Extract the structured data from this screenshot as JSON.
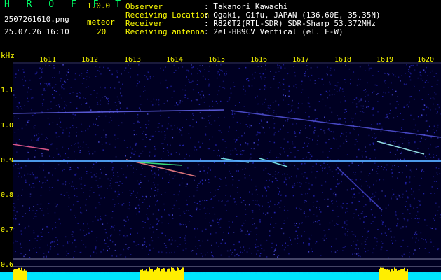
{
  "header": {
    "app_title": "H R O F F T",
    "app_version": "1.0.0",
    "file_name": "2507261610.png",
    "date_time": "25.07.26 16:10",
    "meteor_label": "meteor",
    "meteor_count": "20"
  },
  "station_info": [
    {
      "label": "Observer",
      "value": ": Takanori Kawachi"
    },
    {
      "label": "Receiving Location",
      "value": ": Ogaki, Gifu, JAPAN (136.60E, 35.35N)"
    },
    {
      "label": "Receiver",
      "value": ": R820T2(RTL-SDR) SDR-Sharp 53.372MHz"
    },
    {
      "label": "Receiving antenna",
      "value": ": 2el-HB9CV Vertical (el. E-W)"
    }
  ],
  "spectrogram": {
    "y_unit": "kHz",
    "y_ticks": [
      "1.1",
      "1.0",
      "0.9",
      "0.8",
      "0.7",
      "0.6"
    ],
    "x_ticks": [
      "1611",
      "1612",
      "1613",
      "1614",
      "1615",
      "1616",
      "1617",
      "1618",
      "1619",
      "1620"
    ],
    "colors": {
      "background": "#000022",
      "noise": "#2a2acc",
      "carrier": "#55aaff",
      "level": "#00e5ff",
      "peak": "#ffee00"
    }
  }
}
